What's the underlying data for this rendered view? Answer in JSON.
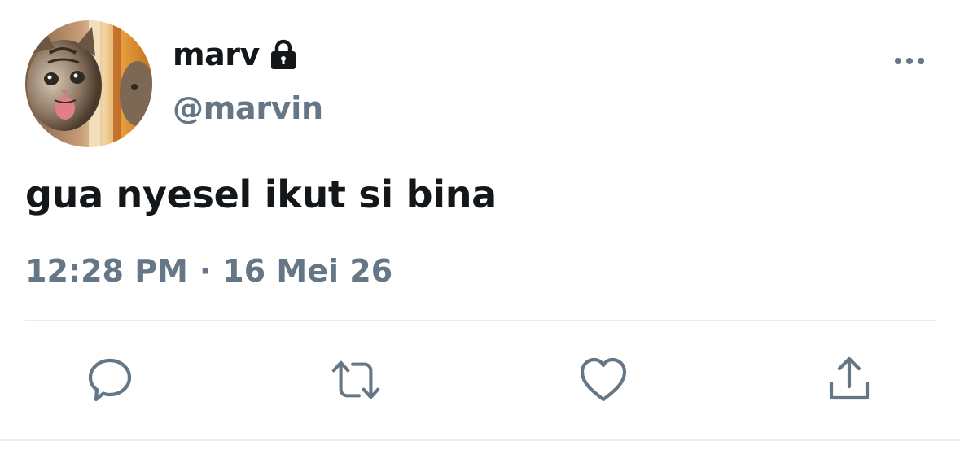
{
  "author": {
    "display_name": "marv",
    "handle": "@marvin",
    "protected": true,
    "avatar_icon": "kitten-avatar"
  },
  "tweet": {
    "text": "gua nyesel ikut si bina",
    "time": "12:28 PM",
    "separator": "·",
    "date": "16 Mei 26"
  },
  "actions": [
    {
      "name": "reply",
      "icon": "reply-icon"
    },
    {
      "name": "retweet",
      "icon": "retweet-icon"
    },
    {
      "name": "like",
      "icon": "heart-icon"
    },
    {
      "name": "share",
      "icon": "share-icon"
    }
  ],
  "colors": {
    "text_primary": "#14171a",
    "text_secondary": "#657786",
    "divider": "#e6ecf0"
  }
}
